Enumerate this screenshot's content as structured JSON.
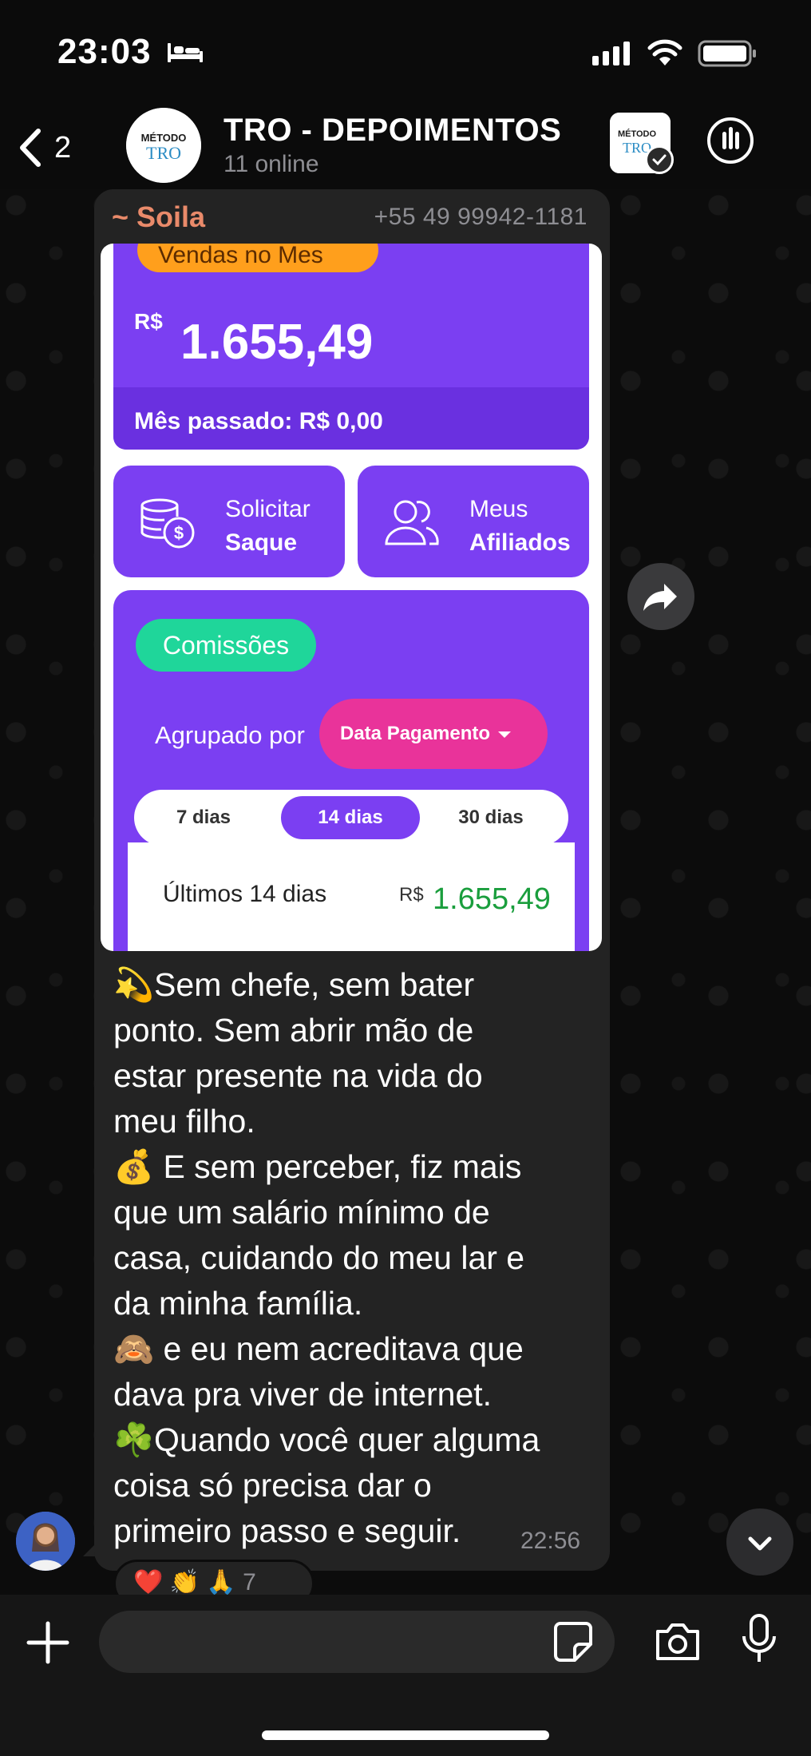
{
  "status_bar": {
    "time": "23:03"
  },
  "header": {
    "back_count": "2",
    "title": "TRO - DEPOIMENTOS",
    "subtitle": "11 online",
    "avatar_text_top": "MÉTODO",
    "avatar_text_bottom": "TRO"
  },
  "message": {
    "sender_name": "~ Soila",
    "sender_phone": "+55 49 99942-1181",
    "time": "22:56",
    "lines": [
      "💫Sem chefe, sem bater",
      "ponto. Sem abrir mão de",
      "estar presente na vida do",
      "meu filho.",
      "💰 E sem perceber, fiz mais",
      "que um salário mínimo de",
      "casa, cuidando do meu lar e",
      "da minha família.",
      "🙈 e eu nem acreditava que",
      "dava pra viver de internet.",
      "☘️Quando você quer alguma",
      "coisa só precisa dar o",
      "primeiro passo e seguir."
    ],
    "reactions": "❤️ 👏 🙏",
    "reaction_count": "7"
  },
  "screenshot": {
    "vendas_label": "Vendas no Mes",
    "currency": "R$",
    "amount": "1.655,49",
    "last_month_label": "Mês passado:",
    "last_month_value": "R$ 0,00",
    "action1_line1": "Solicitar",
    "action1_line2": "Saque",
    "action2_line1": "Meus",
    "action2_line2": "Afiliados",
    "commissions_label": "Comissões",
    "group_label": "Agrupado por",
    "group_select": "Data Pagamento",
    "tabs": [
      "7 dias",
      "14 dias",
      "30 dias"
    ],
    "period_label": "Últimos 14 dias",
    "period_currency": "R$",
    "period_value": "1.655,49"
  },
  "input": {
    "placeholder": ""
  },
  "colors": {
    "accent_purple": "#7b3ff2",
    "commission_green": "#1fd69a",
    "select_pink": "#e9339a",
    "sender_name": "#e98a6a"
  }
}
